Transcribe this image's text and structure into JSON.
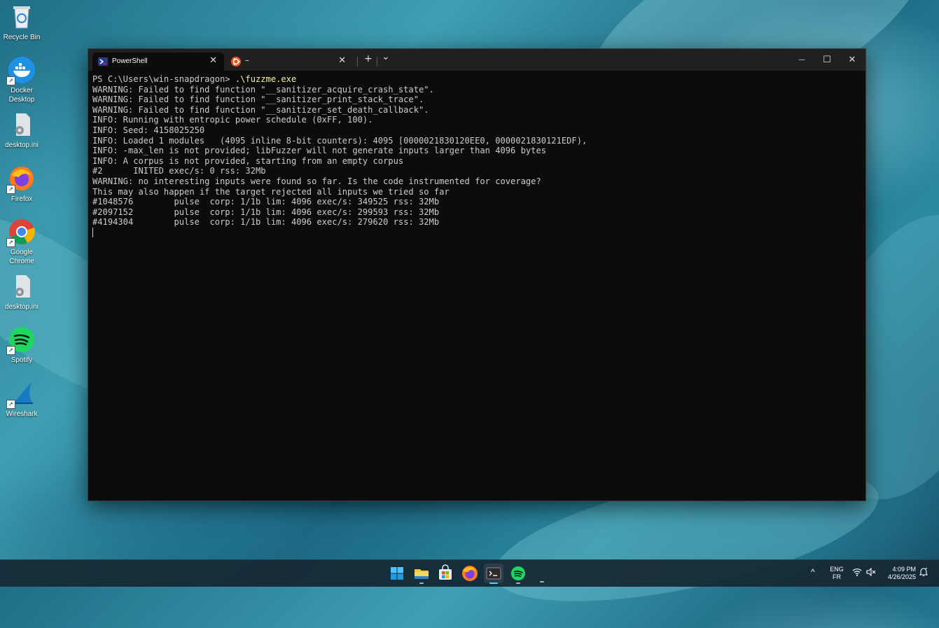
{
  "desktop": {
    "icons": [
      {
        "label": "Recycle Bin"
      },
      {
        "label": "Docker\nDesktop"
      },
      {
        "label": "desktop.ini"
      },
      {
        "label": "Firefox"
      },
      {
        "label": "Google\nChrome"
      },
      {
        "label": "desktop.ini"
      },
      {
        "label": "Spotify"
      },
      {
        "label": "Wireshark"
      }
    ]
  },
  "terminal": {
    "tabs": [
      {
        "title": "PowerShell",
        "icon": "powershell-icon"
      },
      {
        "title": "~",
        "icon": "ubuntu-icon"
      }
    ],
    "prompt": "PS C:\\Users\\win-snapdragon> ",
    "command": ".\\fuzzme.exe",
    "output": [
      "WARNING: Failed to find function \"__sanitizer_acquire_crash_state\".",
      "WARNING: Failed to find function \"__sanitizer_print_stack_trace\".",
      "WARNING: Failed to find function \"__sanitizer_set_death_callback\".",
      "INFO: Running with entropic power schedule (0xFF, 100).",
      "INFO: Seed: 4158025250",
      "INFO: Loaded 1 modules   (4095 inline 8-bit counters): 4095 [0000021830120EE0, 0000021830121EDF),",
      "INFO: -max_len is not provided; libFuzzer will not generate inputs larger than 4096 bytes",
      "INFO: A corpus is not provided, starting from an empty corpus",
      "#2      INITED exec/s: 0 rss: 32Mb",
      "WARNING: no interesting inputs were found so far. Is the code instrumented for coverage?",
      "This may also happen if the target rejected all inputs we tried so far",
      "#1048576        pulse  corp: 1/1b lim: 4096 exec/s: 349525 rss: 32Mb",
      "#2097152        pulse  corp: 1/1b lim: 4096 exec/s: 299593 rss: 32Mb",
      "#4194304        pulse  corp: 1/1b lim: 4096 exec/s: 279620 rss: 32Mb"
    ],
    "new_tab_symbol": "+",
    "dropdown_symbol": "⌄",
    "close_symbol": "✕",
    "minimize_symbol": "—",
    "maximize_symbol": "☐"
  },
  "taskbar": {
    "apps": [
      "start-icon",
      "file-explorer-icon",
      "microsoft-store-icon",
      "firefox-icon",
      "terminal-icon",
      "spotify-icon"
    ],
    "tray": {
      "chevron": "^",
      "lang_top": "ENG",
      "lang_bottom": "FR",
      "time": "4:09 PM",
      "date": "4/26/2025"
    }
  },
  "colors": {
    "console_bg": "#0c0c0c",
    "console_text": "#cccccc",
    "command_text": "#f9f1a5",
    "accent": "#60cdff"
  }
}
